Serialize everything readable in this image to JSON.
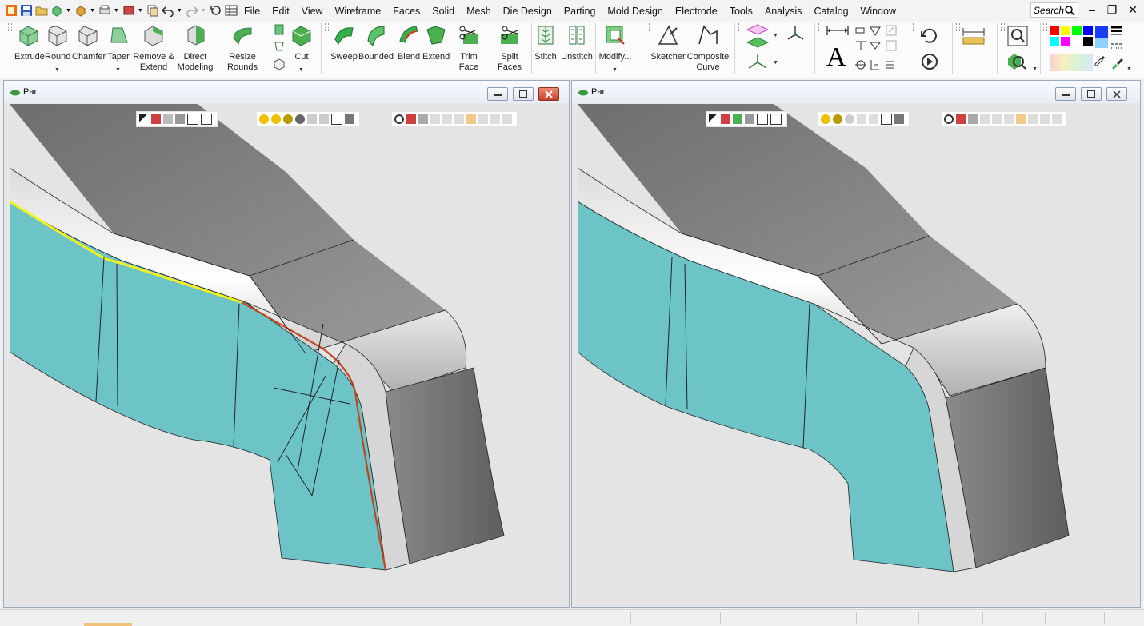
{
  "menubar": {
    "items": [
      "File",
      "Edit",
      "View",
      "Wireframe",
      "Faces",
      "Solid",
      "Mesh",
      "Die Design",
      "Parting",
      "Mold Design",
      "Electrode",
      "Tools",
      "Analysis",
      "Catalog",
      "Window"
    ],
    "search_placeholder": "Search",
    "window_controls": [
      "minimize-icon",
      "restore-icon",
      "close-icon"
    ]
  },
  "ribbon": {
    "solid_tools": [
      "Extrude",
      "Round",
      "Chamfer",
      "Taper"
    ],
    "remove_extend": [
      "Remove &",
      "Extend"
    ],
    "direct_modeling": [
      "Direct",
      "Modeling"
    ],
    "resize_rounds": "Resize Rounds",
    "cut": "Cut",
    "face_tools": [
      "Sweep",
      "Bounded",
      "Blend",
      "Extend",
      "Trim Face",
      "Split Faces"
    ],
    "stitch": "Stitch",
    "unstitch": "Unstitch",
    "modify": "Modify...",
    "sketcher": "Sketcher",
    "composite": [
      "Composite",
      "Curve"
    ],
    "palette": [
      "#ff0000",
      "#ffff00",
      "#00ff00",
      "#0000ff",
      "#00ffff",
      "#ff00ff",
      "#ffffff",
      "#000000"
    ]
  },
  "windows": [
    {
      "title": "Part"
    },
    {
      "title": "Part"
    }
  ],
  "colors": {
    "teal_face": "#6cc4c7",
    "highlight_yellow": "#f5f21a",
    "highlight_red": "#c0441c",
    "grey_top": "#8a8a8a"
  }
}
